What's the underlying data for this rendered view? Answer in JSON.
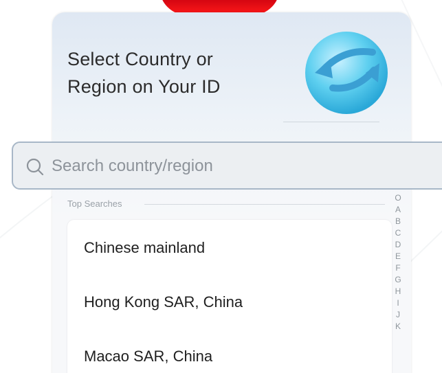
{
  "header": {
    "title_line1": "Select Country or",
    "title_line2": "Region on Your ID"
  },
  "search": {
    "placeholder": "Search country/region",
    "value": ""
  },
  "top_searches": {
    "label": "Top Searches",
    "items": [
      {
        "label": "Chinese mainland"
      },
      {
        "label": "Hong Kong SAR, China"
      },
      {
        "label": "Macao SAR, China"
      }
    ]
  },
  "alphabet_index": [
    "O",
    "A",
    "B",
    "C",
    "D",
    "E",
    "F",
    "G",
    "H",
    "I",
    "J",
    "K"
  ],
  "colors": {
    "accent_red": "#c8000f",
    "globe_blue": "#4fc3e8",
    "search_border": "#a8b7c7"
  },
  "icons": {
    "search": "search-icon",
    "globe": "globe-icon"
  }
}
